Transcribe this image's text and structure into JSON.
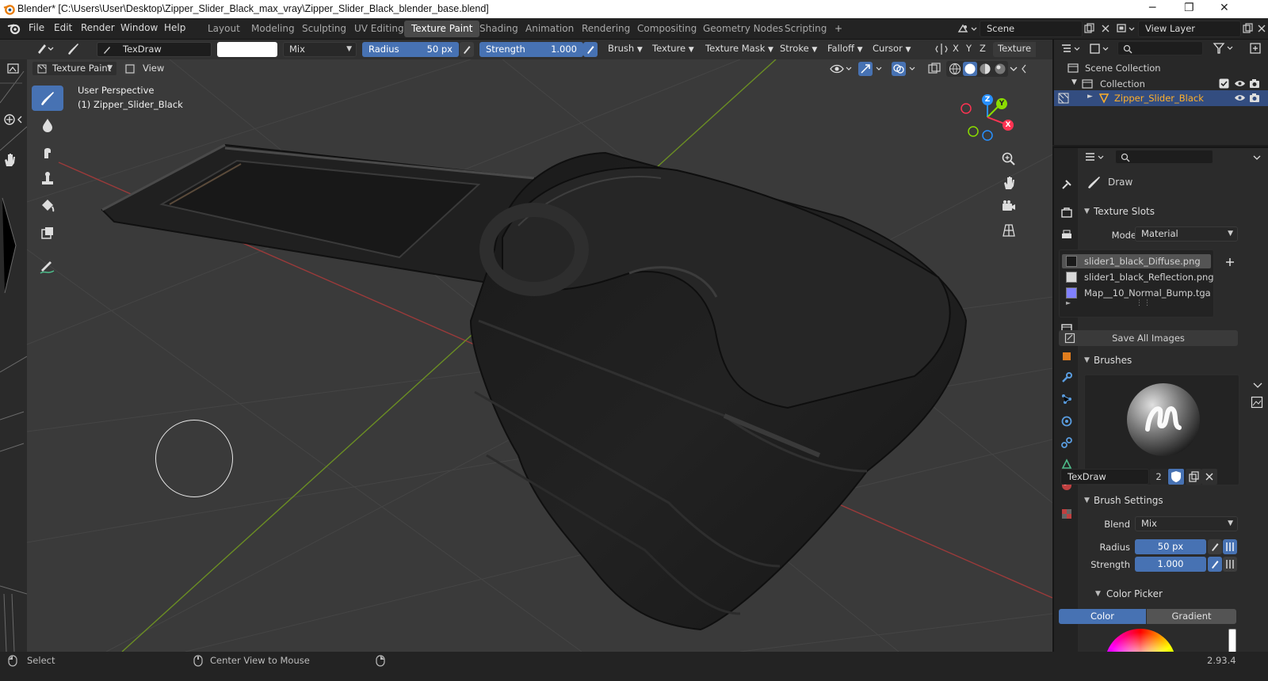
{
  "window": {
    "title": "Blender* [C:\\Users\\User\\Desktop\\Zipper_Slider_Black_max_vray\\Zipper_Slider_Black_blender_base.blend]",
    "minimize": "─",
    "maximize": "❐",
    "close": "✕"
  },
  "menu": [
    "File",
    "Edit",
    "Render",
    "Window",
    "Help"
  ],
  "workspaces": [
    "Layout",
    "Modeling",
    "Sculpting",
    "UV Editing",
    "Texture Paint",
    "Shading",
    "Animation",
    "Rendering",
    "Compositing",
    "Geometry Nodes",
    "Scripting"
  ],
  "active_workspace": "Texture Paint",
  "add_workspace": "+",
  "scene": {
    "label": "Scene"
  },
  "view_layer": {
    "label": "View Layer"
  },
  "tool_header": {
    "brush_name": "TexDraw",
    "blend": "Mix",
    "radius_label": "Radius",
    "radius_value": "50 px",
    "strength_label": "Strength",
    "strength_value": "1.000",
    "brush_menu": "Brush",
    "texture_menu": "Texture",
    "texture_mask_menu": "Texture Mask",
    "stroke_menu": "Stroke",
    "falloff_menu": "Falloff",
    "cursor_menu": "Cursor",
    "axis_x": "X",
    "axis_y": "Y",
    "axis_z": "Z",
    "texture_tab": "Texture"
  },
  "viewport_header": {
    "mode": "Texture Paint",
    "view_menu": "View"
  },
  "viewport": {
    "perspective": "User Perspective",
    "object_label": "(1) Zipper_Slider_Black",
    "gizmo_axes": {
      "x": "X",
      "y": "Y",
      "z": "Z"
    }
  },
  "outliner": {
    "scene_collection": "Scene Collection",
    "collection": "Collection",
    "object": "Zipper_Slider_Black"
  },
  "properties": {
    "tool_name": "Draw",
    "texture_slots_header": "Texture Slots",
    "mode_label": "Mode",
    "mode_value": "Material",
    "slots": [
      {
        "name": "slider1_black_Diffuse.png",
        "color": "#1a1a1a",
        "selected": true
      },
      {
        "name": "slider1_black_Reflection.png",
        "color": "#d8d8d8",
        "selected": false
      },
      {
        "name": "Map__10_Normal_Bump.tga",
        "color": "#8080ff",
        "selected": false
      }
    ],
    "save_all": "Save All Images",
    "brushes_header": "Brushes",
    "brush_name": "TexDraw",
    "brush_users": "2",
    "brush_settings_header": "Brush Settings",
    "blend_label": "Blend",
    "blend_value": "Mix",
    "radius_label": "Radius",
    "radius_value": "50 px",
    "strength_label": "Strength",
    "strength_value": "1.000",
    "color_picker_header": "Color Picker",
    "color_tab": "Color",
    "gradient_tab": "Gradient"
  },
  "status": {
    "select": "Select",
    "center_view": "Center View to Mouse",
    "version": "2.93.4"
  },
  "colors": {
    "accent": "#4772b3",
    "object_orange": "#ffaf29",
    "x_axis": "#ff3352",
    "y_axis": "#8bdc00",
    "z_axis": "#2890ff"
  }
}
